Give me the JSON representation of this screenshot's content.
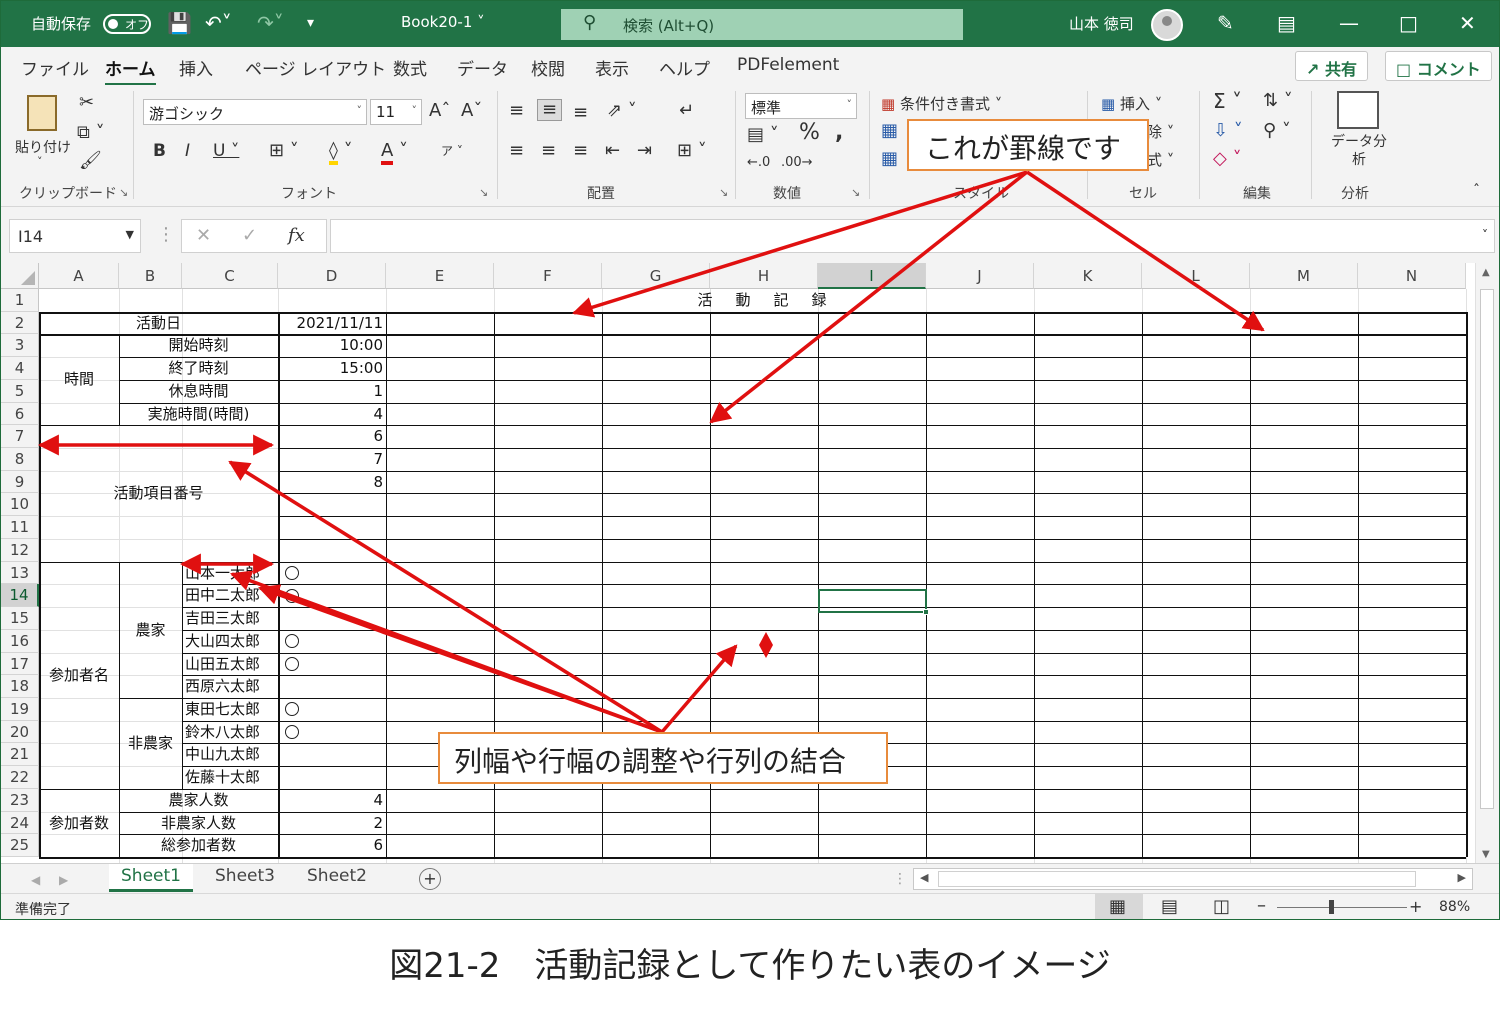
{
  "titlebar": {
    "autosave_label": "自動保存",
    "autosave_state": "オフ",
    "doc_title": "Book20-1",
    "search_placeholder": "検索 (Alt+Q)",
    "user_name": "山本 徳司"
  },
  "menu": {
    "tabs": [
      "ファイル",
      "ホーム",
      "挿入",
      "ページ レイアウト",
      "数式",
      "データ",
      "校閲",
      "表示",
      "ヘルプ",
      "PDFelement"
    ],
    "active_tab": "ホーム",
    "share_label": "共有",
    "comment_label": "コメント"
  },
  "ribbon": {
    "clipboard": {
      "paste_label": "貼り付け",
      "group_label": "クリップボード"
    },
    "font": {
      "font_name": "游ゴシック",
      "font_size": "11",
      "group_label": "フォント"
    },
    "alignment": {
      "group_label": "配置"
    },
    "number": {
      "format": "標準",
      "group_label": "数値"
    },
    "styles": {
      "conditional_label": "条件付き書式",
      "group_label": "スタイル"
    },
    "cells": {
      "insert_label": "挿入",
      "delete_partial": "除",
      "format_partial": "式",
      "group_label": "セル"
    },
    "editing": {
      "group_label": "編集"
    },
    "analysis": {
      "data_analysis_label": "データ分析",
      "group_label": "分析"
    }
  },
  "formula_bar": {
    "name_box": "I14",
    "formula": ""
  },
  "grid": {
    "columns": [
      "A",
      "B",
      "C",
      "D",
      "E",
      "F",
      "G",
      "H",
      "I",
      "J",
      "K",
      "L",
      "M",
      "N"
    ],
    "selected_column": "I",
    "rows": [
      "1",
      "2",
      "3",
      "4",
      "5",
      "6",
      "7",
      "8",
      "9",
      "10",
      "11",
      "12",
      "13",
      "14",
      "15",
      "16",
      "17",
      "18",
      "19",
      "20",
      "21",
      "22",
      "23",
      "24",
      "25"
    ],
    "selected_row": "14",
    "title": "活　動　記　録",
    "activity_day_label": "活動日",
    "activity_day_value": "2021/11/11",
    "time_label": "時間",
    "time_rows": [
      {
        "label": "開始時刻",
        "value": "10:00"
      },
      {
        "label": "終了時刻",
        "value": "15:00"
      },
      {
        "label": "休息時間",
        "value": "1"
      },
      {
        "label": "実施時間(時間)",
        "value": "4"
      }
    ],
    "activity_items_label": "活動項目番号",
    "activity_items": [
      "6",
      "7",
      "8",
      "",
      "",
      ""
    ],
    "participants_label": "参加者名",
    "farmer_label": "農家",
    "nonfarmer_label": "非農家",
    "participants": [
      {
        "name": "山本一太郎",
        "mark": "○"
      },
      {
        "name": "田中二太郎",
        "mark": "○"
      },
      {
        "name": "吉田三太郎",
        "mark": ""
      },
      {
        "name": "大山四太郎",
        "mark": "○"
      },
      {
        "name": "山田五太郎",
        "mark": "○"
      },
      {
        "name": "西原六太郎",
        "mark": ""
      },
      {
        "name": "東田七太郎",
        "mark": "○"
      },
      {
        "name": "鈴木八太郎",
        "mark": "○"
      },
      {
        "name": "中山九太郎",
        "mark": ""
      },
      {
        "name": "佐藤十太郎",
        "mark": ""
      }
    ],
    "count_label": "参加者数",
    "counts": [
      {
        "label": "農家人数",
        "value": "4"
      },
      {
        "label": "非農家人数",
        "value": "2"
      },
      {
        "label": "総参加者数",
        "value": "6"
      }
    ]
  },
  "sheets": {
    "tabs": [
      "Sheet1",
      "Sheet3",
      "Sheet2"
    ],
    "active": "Sheet1"
  },
  "status": {
    "ready": "準備完了",
    "zoom": "88%"
  },
  "annotations": {
    "borders_callout": "これが罫線です",
    "merge_callout": "列幅や行幅の調整や行列の結合",
    "arrow_color": "#e01010",
    "callout_border_color": "#e88b3c"
  },
  "caption": "図21-2　活動記録として作りたい表のイメージ",
  "colors": {
    "excel_green": "#217346",
    "search_bg": "#9fd1b4"
  }
}
